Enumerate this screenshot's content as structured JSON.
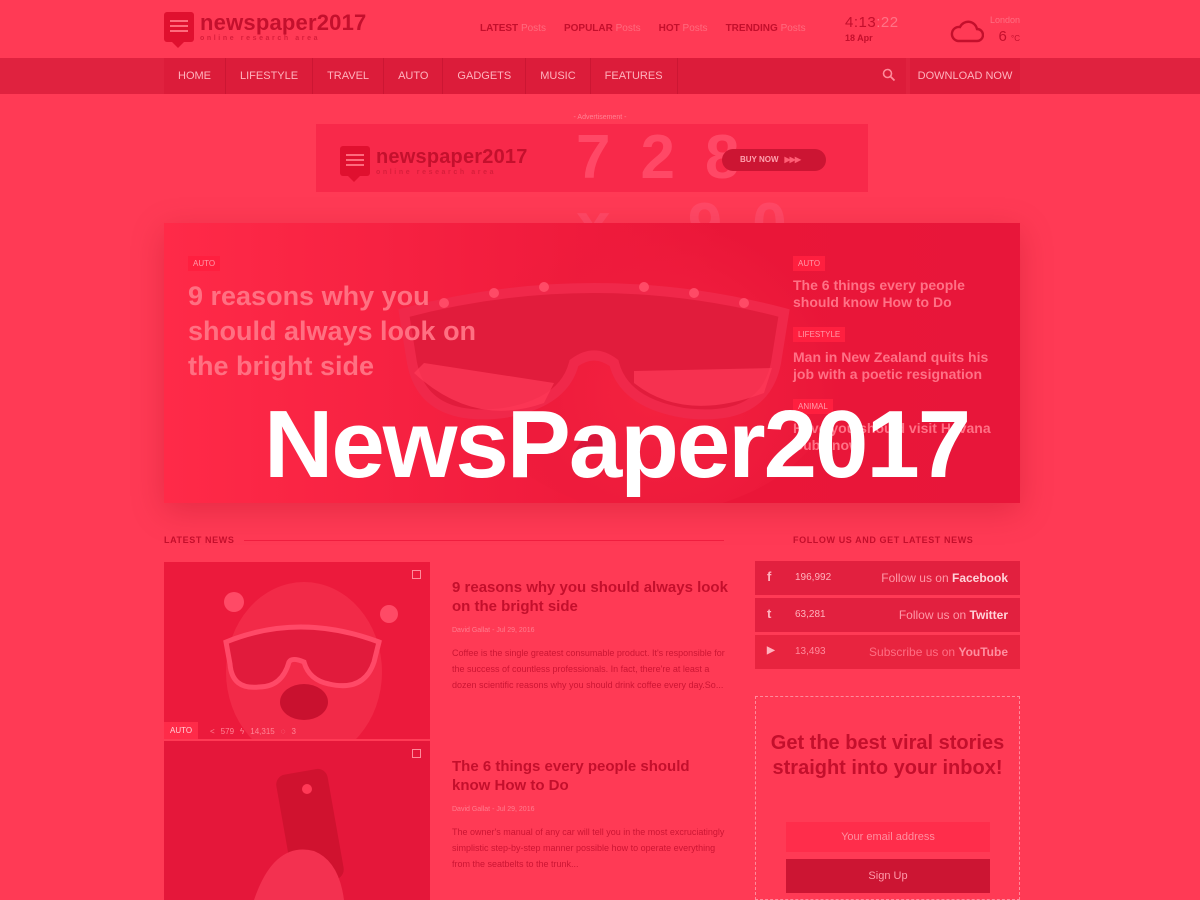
{
  "brand": {
    "name": "newspaper2017",
    "tagline": "online research area"
  },
  "top_links": [
    {
      "bold": "LATEST",
      "rest": "Posts"
    },
    {
      "bold": "POPULAR",
      "rest": "Posts"
    },
    {
      "bold": "HOT",
      "rest": "Posts"
    },
    {
      "bold": "TRENDING",
      "rest": "Posts"
    }
  ],
  "clock": {
    "time": "4:13",
    "seconds": ":22",
    "date": "18 Apr"
  },
  "weather": {
    "city": "London",
    "temp": "6",
    "unit": "°C",
    "icon": "cloud-icon"
  },
  "nav": {
    "items": [
      "HOME",
      "LIFESTYLE",
      "TRAVEL",
      "AUTO",
      "GADGETS",
      "MUSIC",
      "FEATURES"
    ],
    "download": "DOWNLOAD NOW",
    "search_icon": "search-icon"
  },
  "ad": {
    "label": "- Advertisement -",
    "button": "BUY NOW",
    "arrows": "▶▶▶",
    "bg_text": "728 x 90"
  },
  "hero": {
    "main": {
      "tag": "AUTO",
      "title": "9 reasons why you should always look on the bright side"
    },
    "side": [
      {
        "tag": "AUTO",
        "title": "The 6 things every people should know How to Do"
      },
      {
        "tag": "LIFESTYLE",
        "title": "Man in New Zealand quits his job with a poetic resignation"
      },
      {
        "tag": "ANIMAL",
        "title": "Have you should visit Havana Cuba now"
      }
    ]
  },
  "overlay_title": "NewsPaper2017",
  "latest": {
    "heading": "LATEST NEWS",
    "items": [
      {
        "title": "9 reasons why you should always look on the bright side",
        "meta": "David Gallat - Jul 29, 2016",
        "excerpt": "Coffee is the single greatest consumable product. It's responsible for the success of countless professionals. In fact, there're at least a dozen scientific reasons why you should drink coffee every day.So...",
        "tag": "AUTO",
        "shares": "579",
        "views": "14,315",
        "comments": "3"
      },
      {
        "title": "The 6 things every people should know How to Do",
        "meta": "David Gallat - Jul 29, 2016",
        "excerpt": "The owner's manual of any car will tell you in the most excruciatingly simplistic step-by-step manner possible how to operate everything from the seatbelts to the trunk..."
      }
    ]
  },
  "follow": {
    "heading": "FOLLOW US AND GET LATEST NEWS",
    "networks": [
      {
        "icon": "facebook-icon",
        "glyph": "f",
        "count": "196,992",
        "prefix": "Follow us on",
        "name": "Facebook"
      },
      {
        "icon": "twitter-icon",
        "glyph": "t",
        "count": "63,281",
        "prefix": "Follow us on",
        "name": "Twitter"
      },
      {
        "icon": "youtube-icon",
        "glyph": "▶",
        "count": "13,493",
        "prefix": "Subscribe us on",
        "name": "YouTube"
      }
    ]
  },
  "subscribe": {
    "title": "Get the best viral stories straight into your inbox!",
    "placeholder": "Your email address",
    "button": "Sign Up"
  }
}
